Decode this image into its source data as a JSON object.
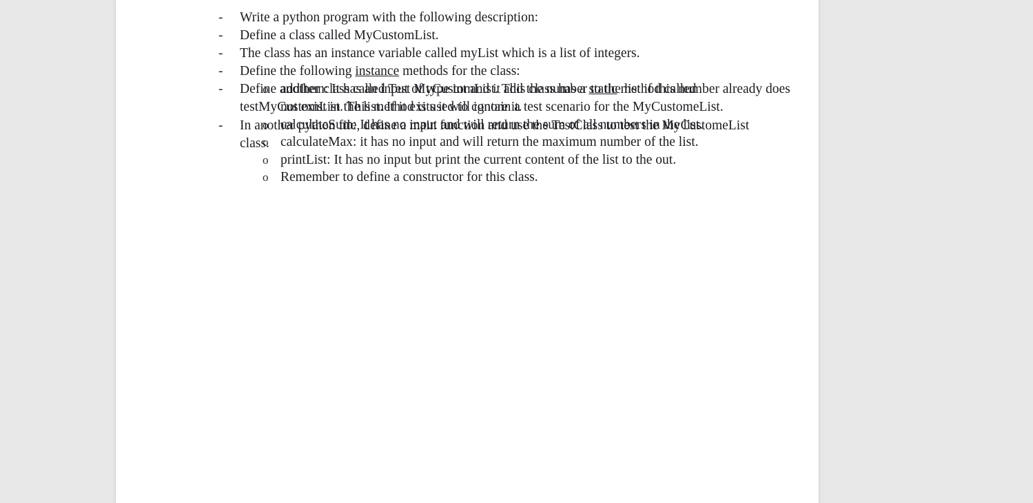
{
  "document": {
    "page_background": "#ffffff",
    "canvas_background": "#e7e7e7",
    "text_color": "#1d1d22",
    "markers": {
      "level1": "-",
      "level2": "o"
    },
    "bullets": [
      {
        "marker": "-",
        "text": "Write a python program with the following description:"
      },
      {
        "marker": "-",
        "text": "Define a class called MyCustomList."
      },
      {
        "marker": "-",
        "text": "The class has an instance variable called myList which is a list of integers."
      },
      {
        "marker": "-",
        "text_before": "Define the following ",
        "underlined": "instance",
        "text_after": " methods for the class:",
        "subitems": [
          {
            "marker": "o",
            "text": "addItem: It has an input of type int and it add the number to the list if this number already does not exist in the list. If it exits it will ignore it."
          },
          {
            "marker": "o",
            "text": "calculateSum: It has no input and will return the sum of all numbers in the list."
          },
          {
            "marker": "o",
            "text": "calculateMax: it has no input and will return the maximum number of the list."
          },
          {
            "marker": "o",
            "text": "printList: It has no input but print the current content of the list to the out."
          },
          {
            "marker": "o",
            "text": "Remember to define a constructor for this class."
          }
        ]
      },
      {
        "marker": "-",
        "text_before": "Define another class called Test MyCustomList. This class has a ",
        "underlined": "static",
        "text_after": " method called testMyCustomList. This method is used to contain a test scenario for the MyCustomeList."
      },
      {
        "marker": "-",
        "text": "In another python file, define a main function and use the TestClass to test the MyCustomeList class."
      }
    ]
  }
}
